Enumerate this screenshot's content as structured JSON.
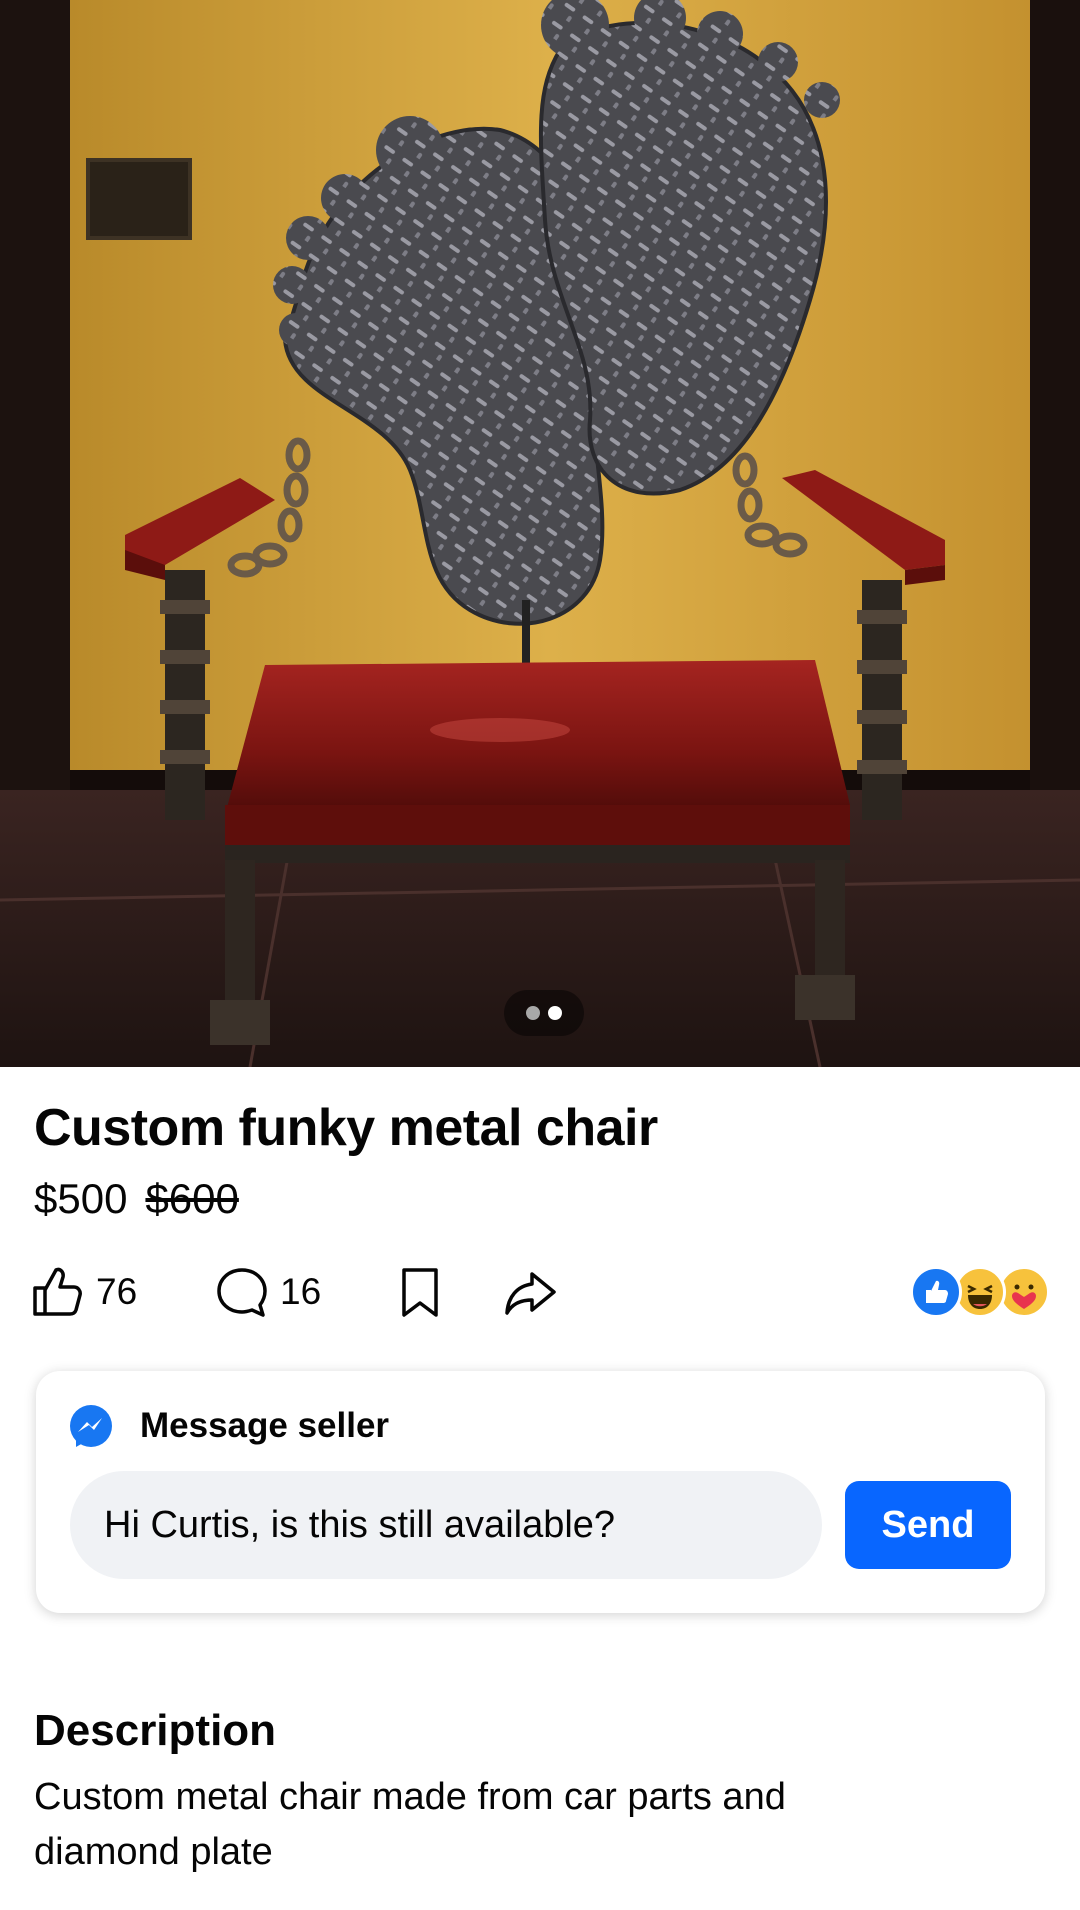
{
  "listing": {
    "title": "Custom funky metal chair",
    "price": "$500",
    "original_price": "$600"
  },
  "photo": {
    "page_indicator": {
      "total": 2,
      "current": 2
    }
  },
  "actions": {
    "like_count": "76",
    "comment_count": "16",
    "icons": [
      "like-icon",
      "comment-icon",
      "save-icon",
      "share-icon"
    ],
    "reactions": [
      "like-reaction",
      "haha-reaction",
      "care-reaction"
    ]
  },
  "message": {
    "header": "Message seller",
    "input_value": "Hi Curtis, is this still available?",
    "send_label": "Send"
  },
  "description": {
    "heading": "Description",
    "text": "Custom metal chair made from car parts and diamond plate"
  },
  "colors": {
    "send_button": "#0866ff",
    "messenger_blue": "#1877f2",
    "input_bg": "#f0f2f5",
    "wall_yellow": "#d9a53a",
    "seat_red": "#8e1a16"
  }
}
